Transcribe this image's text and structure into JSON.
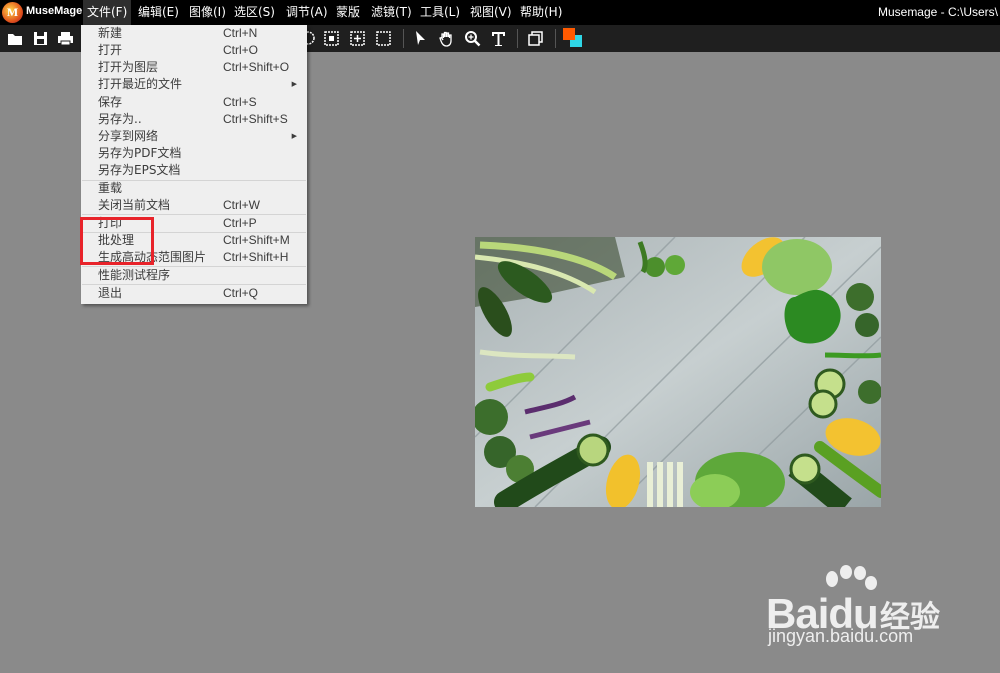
{
  "app": {
    "name": "MuseMage",
    "window_title": "Musemage - C:\\Users\\"
  },
  "menubar": {
    "items": [
      "文件(F)",
      "编辑(E)",
      "图像(I)",
      "选区(S)",
      "调节(A)",
      "蒙版",
      "滤镜(T)",
      "工具(L)",
      "视图(V)",
      "帮助(H)"
    ],
    "active_index": 0
  },
  "toolbar": {
    "icons": [
      "open-icon",
      "save-icon",
      "print-icon",
      "lasso-icon",
      "rect-select-icon",
      "smart-select-icon",
      "select-none-icon",
      "pointer-icon",
      "hand-icon",
      "zoom-icon",
      "text-icon",
      "layers-icon",
      "color-swatch-icon"
    ],
    "foreground_color": "#ff5a00",
    "background_color": "#2fd6e6"
  },
  "file_menu": {
    "items": [
      {
        "label": "新建",
        "shortcut": "Ctrl+N"
      },
      {
        "label": "打开",
        "shortcut": "Ctrl+O"
      },
      {
        "label": "打开为图层",
        "shortcut": "Ctrl+Shift+O"
      },
      {
        "label": "打开最近的文件",
        "shortcut": "",
        "submenu": true
      },
      {
        "label": "保存",
        "shortcut": "Ctrl+S"
      },
      {
        "label": "另存为..",
        "shortcut": "Ctrl+Shift+S"
      },
      {
        "label": "分享到网络",
        "shortcut": "",
        "submenu": true
      },
      {
        "label": "另存为PDF文档",
        "shortcut": ""
      },
      {
        "label": "另存为EPS文档",
        "shortcut": ""
      },
      {
        "label": "重载",
        "shortcut": ""
      },
      {
        "label": "关闭当前文档",
        "shortcut": "Ctrl+W"
      },
      {
        "label": "打印",
        "shortcut": "Ctrl+P"
      },
      {
        "label": "批处理",
        "shortcut": "Ctrl+Shift+M"
      },
      {
        "label": "生成高动态范围图片",
        "shortcut": "Ctrl+Shift+H"
      },
      {
        "label": "性能测试程序",
        "shortcut": ""
      },
      {
        "label": "退出",
        "shortcut": "Ctrl+Q"
      }
    ]
  },
  "annotation": {
    "highlight_color": "#e8232a"
  },
  "watermark": {
    "brand": "Baidu",
    "brand_cn": "经验",
    "url": "jingyan.baidu.com"
  }
}
